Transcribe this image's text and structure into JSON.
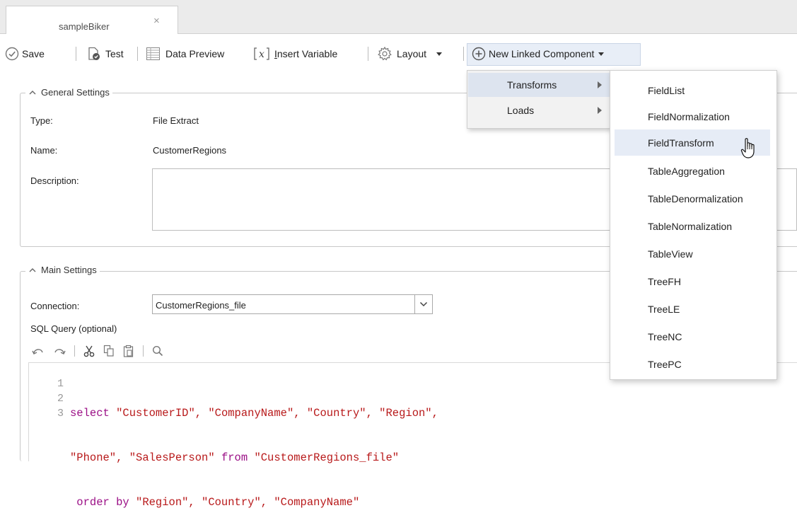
{
  "tab": {
    "title": "sampleBiker",
    "close": "×"
  },
  "toolbar": {
    "save": "Save",
    "test": "Test",
    "data_preview": "Data Preview",
    "insert_variable_prefix": "I",
    "insert_variable_rest": "nsert Variable",
    "layout": "Layout",
    "new_linked_component": "New Linked Component"
  },
  "general": {
    "title": "General Settings",
    "type_label": "Type:",
    "type_value": "File Extract",
    "name_label": "Name:",
    "name_value": "CustomerRegions",
    "description_label": "Description:"
  },
  "main": {
    "title": "Main Settings",
    "connection_label": "Connection:",
    "connection_value": "CustomerRegions_file",
    "sql_label": "SQL Query (optional)"
  },
  "editor": {
    "line_numbers": [
      "1",
      "2",
      "3"
    ],
    "line1": [
      {
        "t": "select ",
        "c": "kw"
      },
      {
        "t": "\"CustomerID\", \"CompanyName\", \"Country\", \"Region\",",
        "c": "str"
      }
    ],
    "line2": [
      {
        "t": "\"Phone\", \"SalesPerson\" ",
        "c": "str"
      },
      {
        "t": "from ",
        "c": "kw"
      },
      {
        "t": "\"CustomerRegions_file\"",
        "c": "str"
      }
    ],
    "line3": [
      {
        "t": " order by ",
        "c": "kw"
      },
      {
        "t": "\"Region\", \"Country\", \"CompanyName\"",
        "c": "str"
      }
    ]
  },
  "menu": {
    "level1": [
      "Transforms",
      "Loads"
    ],
    "level1_selected": "Transforms",
    "level2": [
      "FieldList",
      "FieldNormalization",
      "FieldTransform",
      "TableAggregation",
      "TableDenormalization",
      "TableNormalization",
      "TableView",
      "TreeFH",
      "TreeLE",
      "TreeNC",
      "TreePC"
    ],
    "level2_hovered": "FieldTransform"
  },
  "colors": {
    "keyword": "#9b0f86",
    "string": "#b8191a",
    "hover": "#e6ecf6"
  }
}
